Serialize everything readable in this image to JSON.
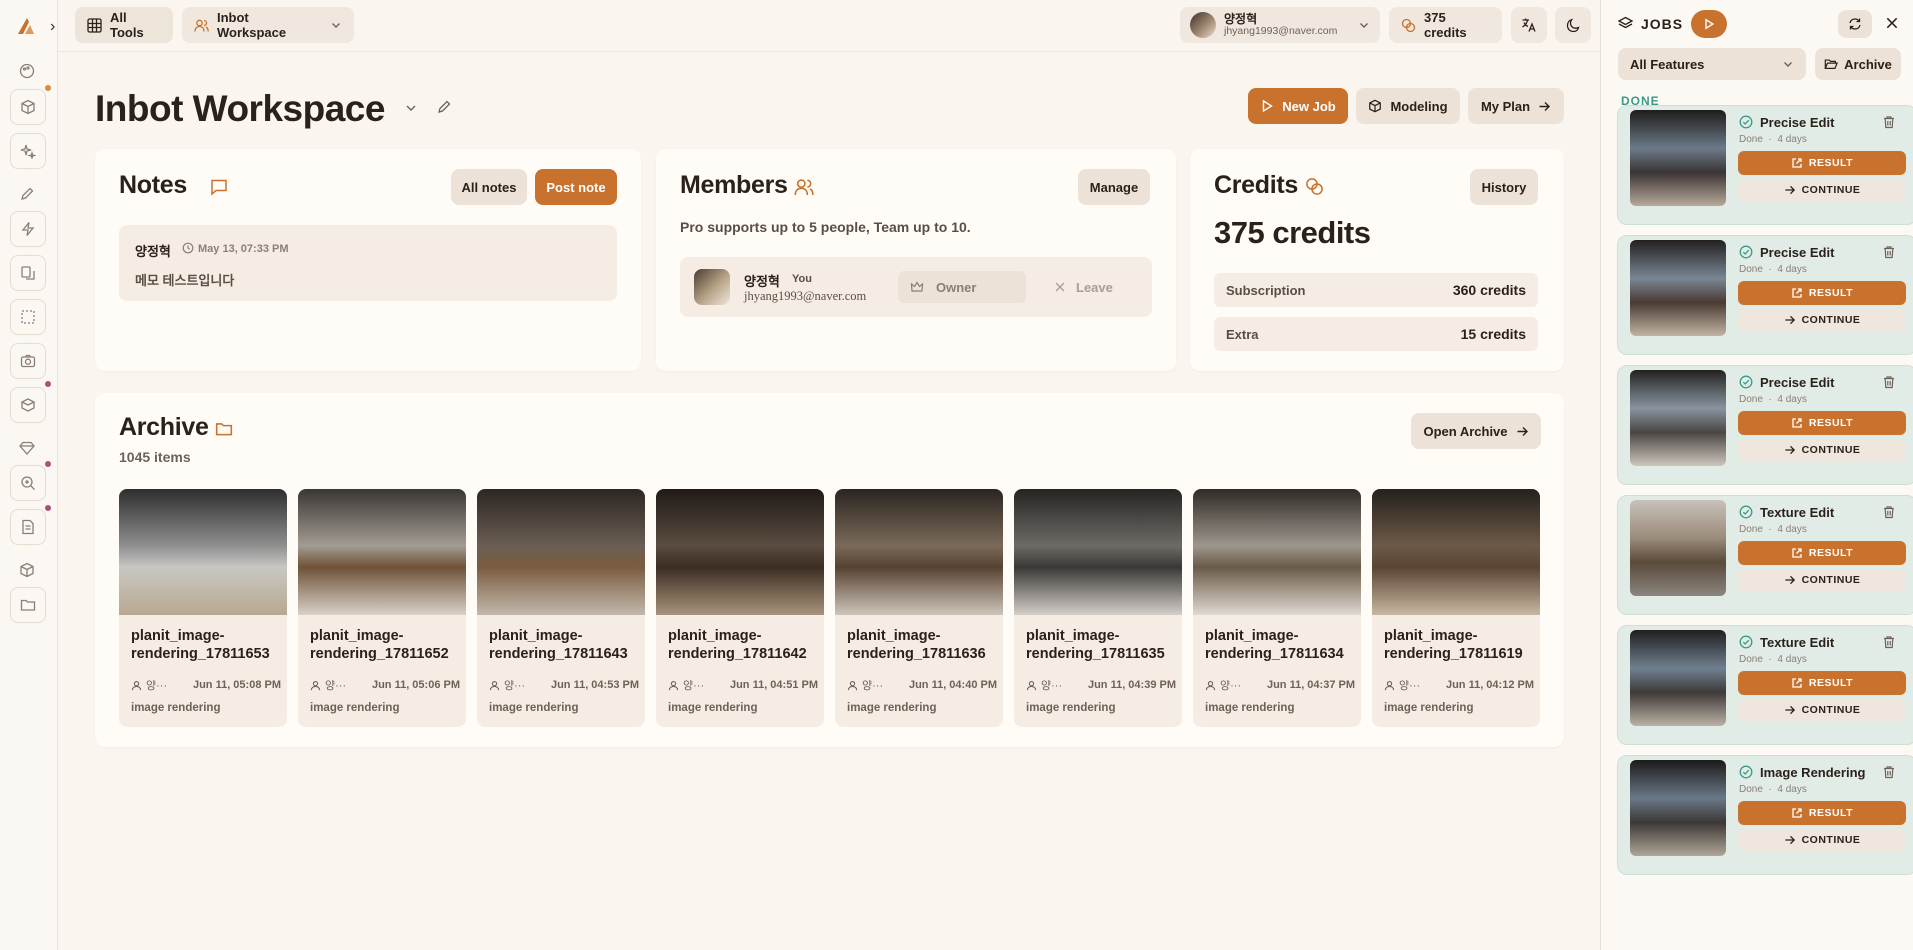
{
  "topbar": {
    "all_tools": "All Tools",
    "workspace": "Inbot Workspace",
    "user_name": "양정혁",
    "user_email": "jhyang1993@naver.com",
    "credits": "375 credits"
  },
  "page": {
    "title": "Inbot Workspace",
    "new_job": "New Job",
    "modeling": "Modeling",
    "my_plan": "My Plan"
  },
  "notes": {
    "title": "Notes",
    "all_notes": "All notes",
    "post_note": "Post note",
    "items": [
      {
        "author": "양정혁",
        "time": "May 13, 07:33 PM",
        "text": "메모 테스트입니다"
      }
    ]
  },
  "members": {
    "title": "Members",
    "manage": "Manage",
    "info": "Pro supports up to 5 people, Team up to 10.",
    "items": [
      {
        "name": "양정혁",
        "tag": "You",
        "email": "jhyang1993@naver.com",
        "role": "Owner",
        "leave": "Leave"
      }
    ]
  },
  "credits": {
    "title": "Credits",
    "history": "History",
    "total": "375 credits",
    "rows": [
      {
        "label": "Subscription",
        "value": "360 credits"
      },
      {
        "label": "Extra",
        "value": "15 credits"
      }
    ]
  },
  "archive": {
    "title": "Archive",
    "count": "1045 items",
    "open": "Open Archive",
    "items": [
      {
        "name1": "planit_image-",
        "name2": "rendering_17811653",
        "owner": "양···",
        "date": "Jun 11, 05:08 PM",
        "category": "image rendering"
      },
      {
        "name1": "planit_image-",
        "name2": "rendering_17811652",
        "owner": "양···",
        "date": "Jun 11, 05:06 PM",
        "category": "image rendering"
      },
      {
        "name1": "planit_image-",
        "name2": "rendering_17811643",
        "owner": "양···",
        "date": "Jun 11, 04:53 PM",
        "category": "image rendering"
      },
      {
        "name1": "planit_image-",
        "name2": "rendering_17811642",
        "owner": "양···",
        "date": "Jun 11, 04:51 PM",
        "category": "image rendering"
      },
      {
        "name1": "planit_image-",
        "name2": "rendering_17811636",
        "owner": "양···",
        "date": "Jun 11, 04:40 PM",
        "category": "image rendering"
      },
      {
        "name1": "planit_image-",
        "name2": "rendering_17811635",
        "owner": "양···",
        "date": "Jun 11, 04:39 PM",
        "category": "image rendering"
      },
      {
        "name1": "planit_image-",
        "name2": "rendering_17811634",
        "owner": "양···",
        "date": "Jun 11, 04:37 PM",
        "category": "image rendering"
      },
      {
        "name1": "planit_image-",
        "name2": "rendering_17811619",
        "owner": "양···",
        "date": "Jun 11, 04:12 PM",
        "category": "image rendering"
      }
    ]
  },
  "jobs": {
    "title": "JOBS",
    "filter": "All Features",
    "archive": "Archive",
    "section": "DONE",
    "result_label": "RESULT",
    "continue_label": "CONTINUE",
    "items": [
      {
        "title": "Precise Edit",
        "status": "Done",
        "age": "4 days"
      },
      {
        "title": "Precise Edit",
        "status": "Done",
        "age": "4 days"
      },
      {
        "title": "Precise Edit",
        "status": "Done",
        "age": "4 days"
      },
      {
        "title": "Texture Edit",
        "status": "Done",
        "age": "4 days"
      },
      {
        "title": "Texture Edit",
        "status": "Done",
        "age": "4 days"
      },
      {
        "title": "Image Rendering",
        "status": "Done",
        "age": "4 days"
      }
    ]
  },
  "colors": {
    "accent": "#c8722d",
    "background": "#faf5ef",
    "job_done": "#e2ece6",
    "done_label": "#3a9a8a"
  }
}
